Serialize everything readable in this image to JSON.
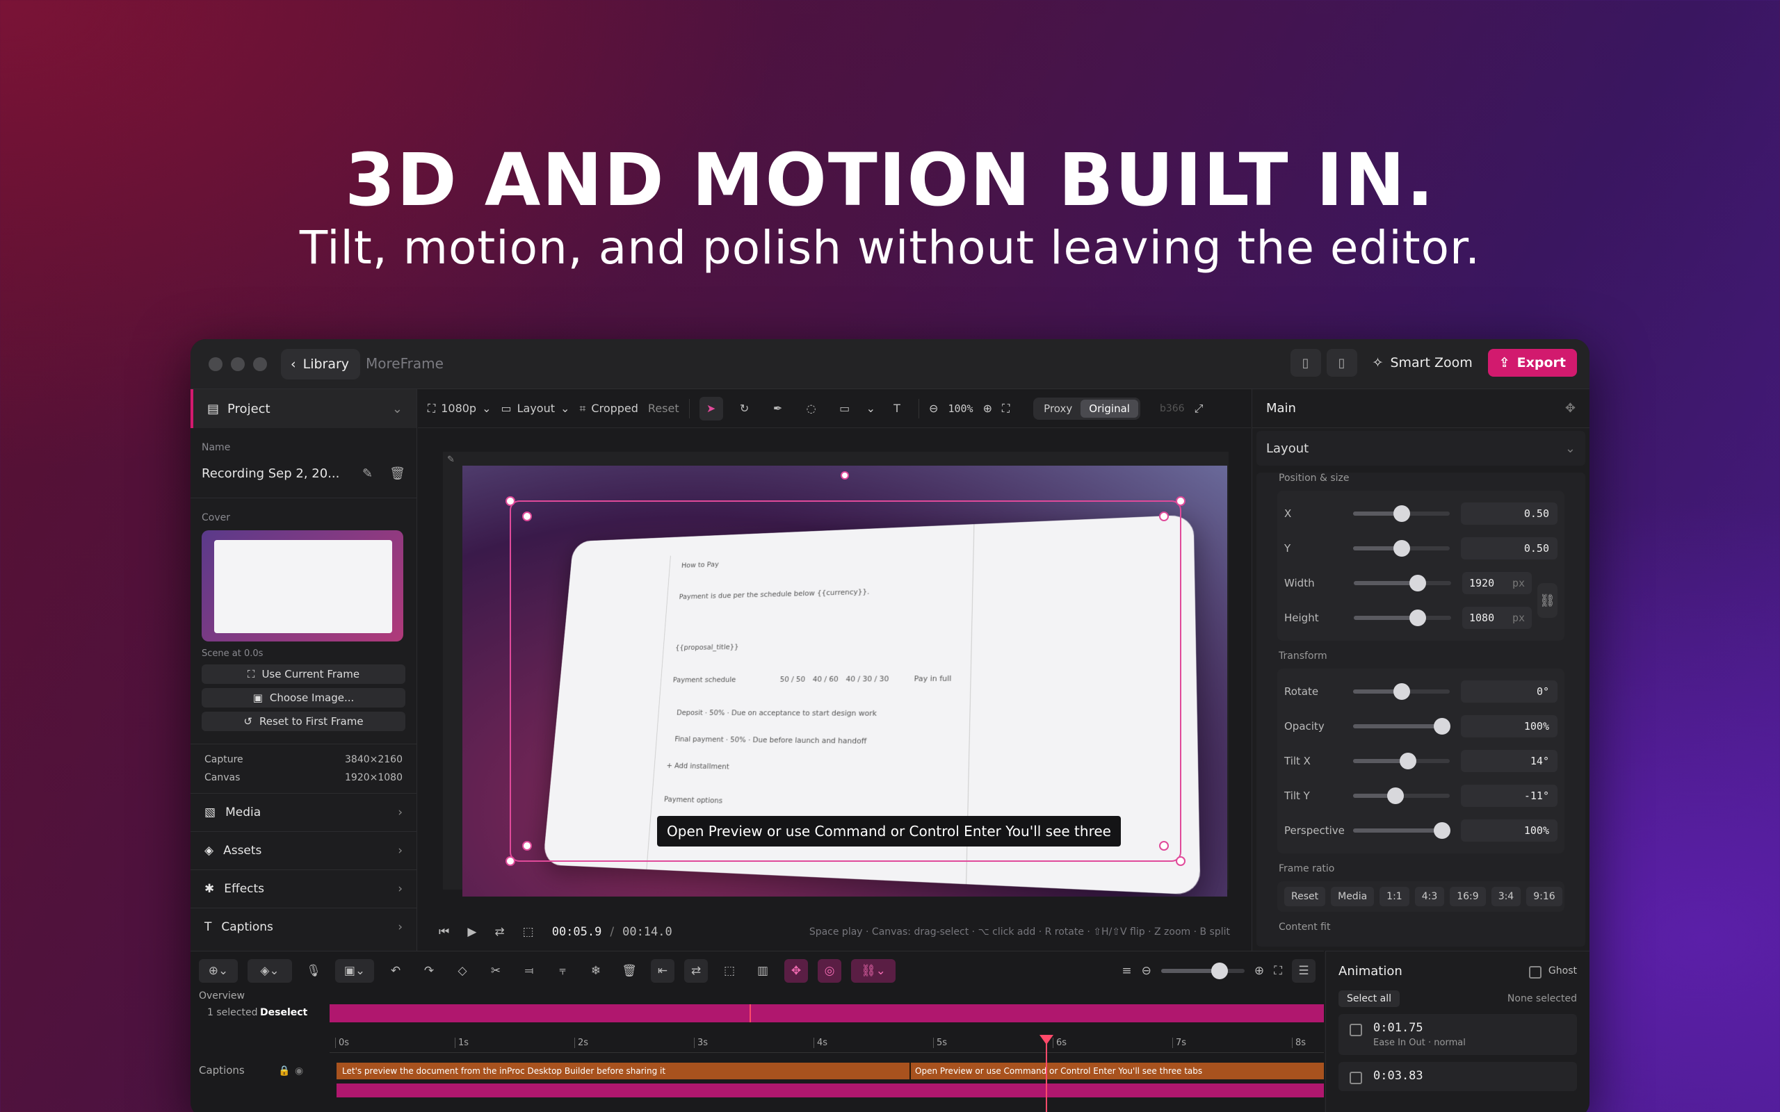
{
  "hero": {
    "title": "3D AND MOTION BUILT IN.",
    "subtitle": "Tilt, motion, and polish without leaving the editor."
  },
  "titlebar": {
    "library_label": "Library",
    "app_name": "MoreFrame",
    "smart_zoom_label": "Smart Zoom",
    "export_label": "Export"
  },
  "project": {
    "header": "Project",
    "name_label": "Name",
    "name_value": "Recording Sep 2, 20...",
    "cover_label": "Cover",
    "scene_label": "Scene at 0.0s",
    "use_current": "Use Current Frame",
    "choose_image": "Choose Image...",
    "reset_first": "Reset to First Frame",
    "capture_label": "Capture",
    "capture_value": "3840×2160",
    "canvas_label": "Canvas",
    "canvas_value": "1920×1080"
  },
  "sections": [
    {
      "label": "Media",
      "icon": "media-icon"
    },
    {
      "label": "Assets",
      "icon": "layers-icon"
    },
    {
      "label": "Effects",
      "icon": "sparkle-icon"
    },
    {
      "label": "Captions",
      "icon": "text-icon"
    }
  ],
  "toolbar": {
    "resolution": "1080p",
    "layout": "Layout",
    "cropped": "Cropped",
    "reset": "Reset",
    "zoom": "100%",
    "proxy": "Proxy",
    "original": "Original",
    "res_badge": "b366"
  },
  "preview": {
    "caption": "Open Preview or use Command or Control Enter You'll see three",
    "doc_lines": [
      "How to Pay",
      "Payment is due per the schedule below {{currency}}.",
      "{{proposal_title}}",
      "Payment schedule",
      "50 / 50",
      "40 / 60",
      "40 / 30 / 30",
      "Pay in full",
      "Deposit · 50% · Due on acceptance to start design work",
      "Final payment · 50% · Due before launch and handoff",
      "+ Add installment",
      "Payment options"
    ]
  },
  "playback": {
    "current": "00:05.9",
    "separator": "/",
    "total": "00:14.0",
    "hint": "Space play · Canvas: drag-select · ⌥ click add · R rotate · ⇧H/⇧V flip · Z zoom · B split"
  },
  "inspector": {
    "title": "Main",
    "layout_label": "Layout",
    "pos_size_label": "Position & size",
    "x_label": "X",
    "x_value": "0.50",
    "x_level": 0.5,
    "y_label": "Y",
    "y_value": "0.50",
    "y_level": 0.5,
    "width_label": "Width",
    "width_value": "1920",
    "width_unit": "px",
    "width_level": 0.66,
    "height_label": "Height",
    "height_value": "1080",
    "height_unit": "px",
    "height_level": 0.66,
    "transform_label": "Transform",
    "rotate_label": "Rotate",
    "rotate_value": "0°",
    "rotate_level": 0.5,
    "opacity_label": "Opacity",
    "opacity_value": "100%",
    "opacity_level": 0.92,
    "tiltx_label": "Tilt X",
    "tiltx_value": "14°",
    "tiltx_level": 0.57,
    "tilty_label": "Tilt Y",
    "tilty_value": "-11°",
    "tilty_level": 0.44,
    "persp_label": "Perspective",
    "persp_value": "100%",
    "persp_level": 0.92,
    "frame_ratio_label": "Frame ratio",
    "ratios": [
      "Reset",
      "Media",
      "1:1",
      "4:3",
      "16:9",
      "3:4",
      "9:16"
    ],
    "content_fit_label": "Content fit"
  },
  "timeline": {
    "overview_label": "Overview",
    "selected_label": "1 selected",
    "deselect_label": "Deselect",
    "captions_track_label": "Captions",
    "ticks": [
      "0s",
      "1s",
      "2s",
      "3s",
      "4s",
      "5s",
      "6s",
      "7s",
      "8s"
    ],
    "caption1": "Let's preview the document from the inProc Desktop Builder before sharing it",
    "caption2": "Open Preview or use Command or Control Enter You'll see three tabs"
  },
  "animation": {
    "title": "Animation",
    "ghost_label": "Ghost",
    "select_all": "Select all",
    "none_selected": "None selected",
    "kf1_time": "0:01.75",
    "kf1_ease": "Ease In Out · normal",
    "kf2_time": "0:03.83"
  },
  "colors": {
    "accent": "#d21a6e",
    "selection": "#e04a9a",
    "caption_track": "#a8521e"
  }
}
